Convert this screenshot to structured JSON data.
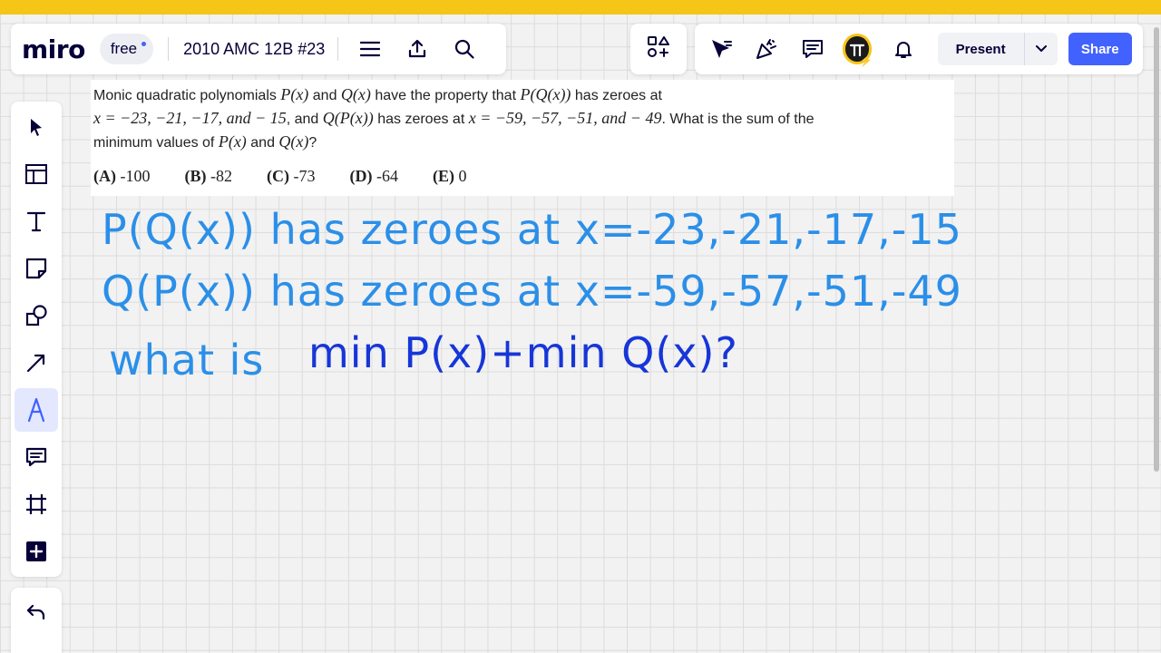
{
  "app": {
    "logo": "miro",
    "plan_badge": "free",
    "board_title": "2010 AMC 12B #23"
  },
  "header_right": {
    "present_label": "Present",
    "share_label": "Share"
  },
  "colors": {
    "top_stripe": "#f5c518",
    "accent": "#4262ff",
    "handwriting_light": "#2b8fe8",
    "handwriting_dark": "#1736d8"
  },
  "toolbar": {
    "tools": [
      "select",
      "templates",
      "text",
      "sticky-note",
      "shapes",
      "connection-line",
      "pen",
      "comment",
      "frame",
      "add-more"
    ]
  },
  "problem": {
    "t1": "Monic quadratic polynomials",
    "m_p": "P(x)",
    "t_and": "and",
    "m_q": "Q(x)",
    "t2": "have the property that",
    "m_pq": "P(Q(x))",
    "t3": "has zeroes at",
    "m_zeros1": "x = −23, −21, −17, and − 15",
    "t4": ", and",
    "m_qp": "Q(P(x))",
    "t5": "has zeroes at",
    "m_zeros2": "x = −59, −57, −51, and − 49",
    "t6": ". What is the sum of the",
    "t7": "minimum values of",
    "m_p2": "P(x)",
    "t_and2": "and",
    "m_q2": "Q(x)",
    "t8": "?",
    "choices": [
      {
        "letter": "(A)",
        "value": "-100"
      },
      {
        "letter": "(B)",
        "value": "-82"
      },
      {
        "letter": "(C)",
        "value": "-73"
      },
      {
        "letter": "(D)",
        "value": "-64"
      },
      {
        "letter": "(E)",
        "value": "0"
      }
    ]
  },
  "handwriting": {
    "line1": "P(Q(x)) has zeroes at x=-23,-21,-17,-15",
    "line2": "Q(P(x)) has zeroes at x=-59,-57,-51,-49",
    "line3_a": "what is",
    "line3_b": "min P(x)+min Q(x)?"
  }
}
